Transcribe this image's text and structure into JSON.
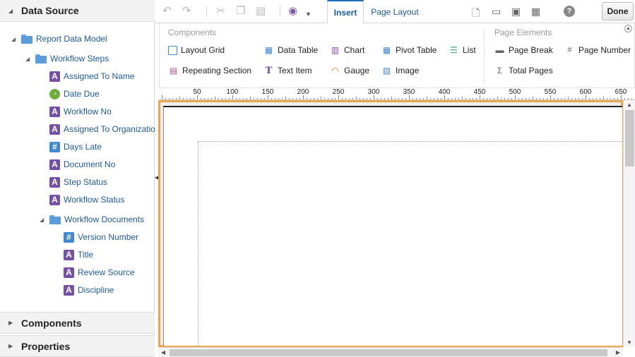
{
  "left_panel": {
    "data_source": {
      "title": "Data Source",
      "tree": [
        {
          "label": "Report Data Model",
          "type": "folder",
          "level": 0
        },
        {
          "label": "Workflow Steps",
          "type": "folder",
          "level": 1
        },
        {
          "label": "Assigned To Name",
          "type": "text",
          "level": 2
        },
        {
          "label": "Date Due",
          "type": "date",
          "level": 2
        },
        {
          "label": "Workflow No",
          "type": "text",
          "level": 2
        },
        {
          "label": "Assigned To Organizatio",
          "type": "text",
          "level": 2
        },
        {
          "label": "Days Late",
          "type": "number",
          "level": 2
        },
        {
          "label": "Document No",
          "type": "text",
          "level": 2
        },
        {
          "label": "Step Status",
          "type": "text",
          "level": 2
        },
        {
          "label": "Workflow Status",
          "type": "text",
          "level": 2
        },
        {
          "label": "Workflow Documents",
          "type": "folder",
          "level": 2
        },
        {
          "label": "Version Number",
          "type": "number",
          "level": 3
        },
        {
          "label": "Title",
          "type": "text",
          "level": 3
        },
        {
          "label": "Review Source",
          "type": "text",
          "level": 3
        },
        {
          "label": "Discipline",
          "type": "text",
          "level": 3
        }
      ]
    },
    "components_title": "Components",
    "properties_title": "Properties"
  },
  "toolbar": {
    "icons": [
      "undo-icon",
      "redo-icon",
      "cut-icon",
      "copy-icon",
      "paste-icon",
      "preview-icon"
    ],
    "tabs": [
      {
        "label": "Insert",
        "active": true
      },
      {
        "label": "Page Layout",
        "active": false
      }
    ],
    "right_icons": [
      "new-layout-icon",
      "open-icon",
      "save-icon",
      "save-as-icon",
      "help-icon"
    ],
    "done_label": "Done"
  },
  "ribbon": {
    "components": {
      "title": "Components",
      "items": [
        {
          "label": "Layout Grid",
          "icon": "layout-grid-icon"
        },
        {
          "label": "Data Table",
          "icon": "data-table-icon"
        },
        {
          "label": "Chart",
          "icon": "chart-icon"
        },
        {
          "label": "Pivot Table",
          "icon": "pivot-table-icon"
        },
        {
          "label": "List",
          "icon": "list-icon"
        },
        {
          "label": "Repeating Section",
          "icon": "repeating-section-icon"
        },
        {
          "label": "Text Item",
          "icon": "text-item-icon"
        },
        {
          "label": "Gauge",
          "icon": "gauge-icon"
        },
        {
          "label": "Image",
          "icon": "image-icon"
        }
      ]
    },
    "page_elements": {
      "title": "Page Elements",
      "items": [
        {
          "label": "Page Break",
          "icon": "page-break-icon"
        },
        {
          "label": "Page Number",
          "icon": "page-number-icon"
        },
        {
          "label": "Total Pages",
          "icon": "total-pages-icon"
        }
      ]
    }
  },
  "ruler": {
    "labels": [
      "50",
      "100",
      "150",
      "200",
      "250",
      "300",
      "350",
      "400",
      "450",
      "500",
      "550",
      "600",
      "650"
    ]
  },
  "colors": {
    "accent": "#1e6fb9",
    "canvas_border": "#e8a850",
    "text_field": "#7452a3",
    "number_field": "#3f89cf",
    "date_field": "#6fae3c"
  }
}
